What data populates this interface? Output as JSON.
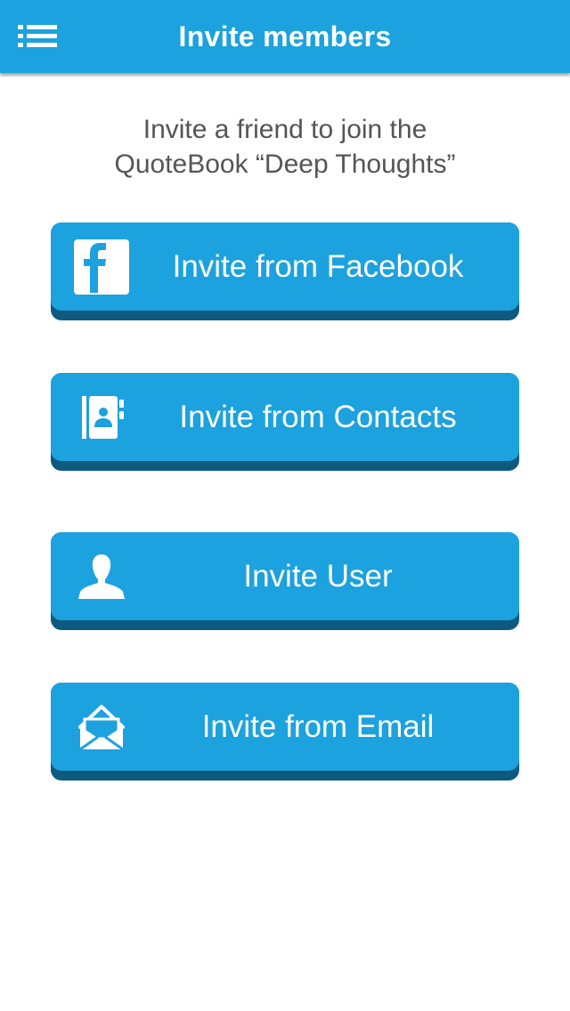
{
  "header": {
    "title": "Invite members",
    "menu_icon": "list-menu-icon"
  },
  "intro": {
    "line1": "Invite a friend to join the",
    "line2": "QuoteBook “Deep Thoughts”"
  },
  "buttons": [
    {
      "label": "Invite from Facebook",
      "icon": "facebook-icon"
    },
    {
      "label": "Invite from Contacts",
      "icon": "address-book-icon"
    },
    {
      "label": "Invite User",
      "icon": "user-icon"
    },
    {
      "label": "Invite from Email",
      "icon": "envelope-icon"
    }
  ],
  "colors": {
    "primary": "#1ca2de",
    "button_shadow": "#0d5a7e",
    "text_muted": "#555555",
    "background": "#ffffff"
  }
}
